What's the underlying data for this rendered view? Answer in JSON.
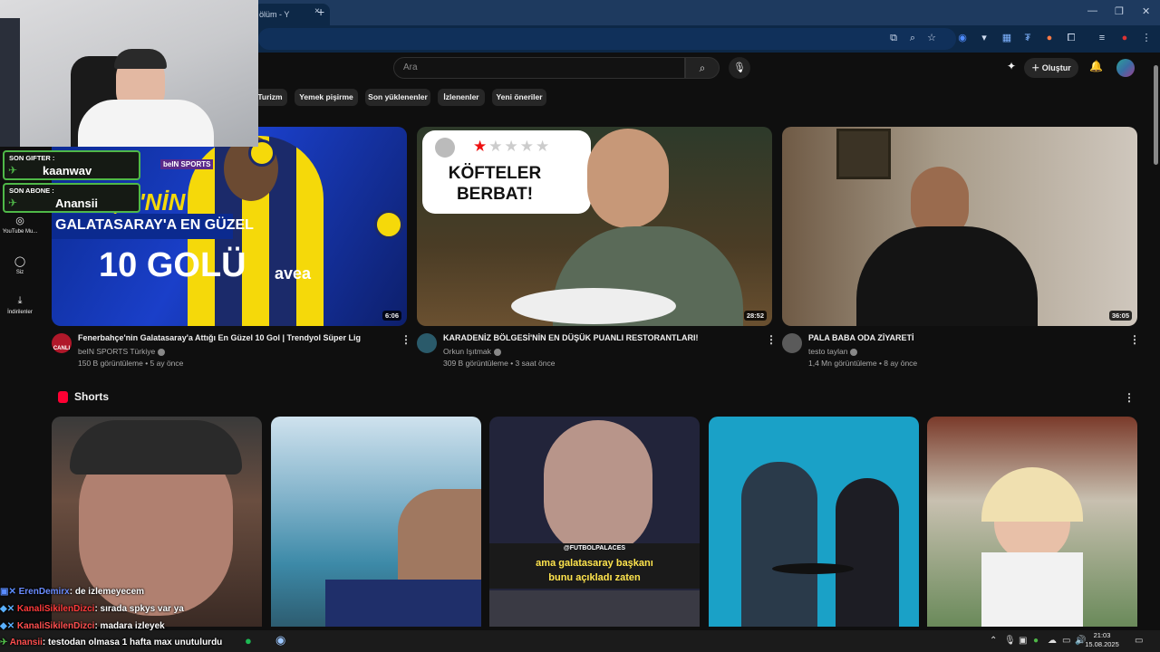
{
  "browser": {
    "tab_title": "ölüm - Y",
    "tab_close": "×",
    "new_tab": "+"
  },
  "header": {
    "search_placeholder": "Ara",
    "create_label": "Oluştur"
  },
  "chips": [
    "Turizm",
    "Yemek pişirme",
    "Son yüklenenler",
    "İzlenenler",
    "Yeni öneriler"
  ],
  "sidebar": {
    "items": [
      {
        "label": "YouTube Mu...",
        "icon": "youtube-music-icon"
      },
      {
        "label": "Siz",
        "icon": "user-icon"
      },
      {
        "label": "İndirilenler",
        "icon": "download-icon"
      }
    ]
  },
  "stream_overlay": {
    "gifter_label": "SON GIFTER :",
    "gifter_name": "kaanwav",
    "sub_label": "SON ABONE :",
    "sub_name": "Anansii"
  },
  "videos": [
    {
      "title": "Fenerbahçe'nin Galatasaray'a Attığı En Güzel 10 Gol | Trendyol Süper Lig",
      "channel": "beIN SPORTS Türkiye",
      "meta": "150 B görüntüleme • 5 ay önce",
      "duration": "6:06",
      "thumb_line1": "BAHÇE'NİN",
      "thumb_line2": "GALATASARAY'A EN GÜZEL",
      "thumb_line3": "10 GOLÜ",
      "thumb_brand": "beIN SPORTS",
      "thumb_sponsor": "avea",
      "avatar_label": "CANLI"
    },
    {
      "title": "KARADENİZ BÖLGESİ'NİN EN DÜŞÜK PUANLI RESTORANTLARI!",
      "channel": "Orkun Işıtmak",
      "meta": "309 B görüntüleme • 3 saat önce",
      "duration": "28:52",
      "thumb_text": "KÖFTELER BERBAT!"
    },
    {
      "title": "PALA BABA ODA ZİYARETİ",
      "channel": "testo taylan",
      "meta": "1,4 Mn görüntüleme • 8 ay önce",
      "duration": "36:05"
    }
  ],
  "shorts": {
    "title": "Shorts",
    "caption_handle": "@FUTBOLPALACES",
    "caption_line1": "ama galatasaray başkanı",
    "caption_line2": "bunu açıkladı zaten"
  },
  "chat": [
    {
      "user": "ErenDemirx",
      "text": ": de izlemeyecem"
    },
    {
      "user": "KanaliSikilenDizci",
      "text": ": sırada spkys var ya"
    },
    {
      "user": "KanaliSikilenDizci",
      "text": ": madara izleyek"
    },
    {
      "user": "Anansii",
      "text": ": testodan olmasa 1 hafta max unutulurdu"
    }
  ],
  "taskbar": {
    "time": "21:03",
    "date": "15.08.2025"
  },
  "colors": {
    "accent_red": "#ff0033",
    "overlay_green": "#4fb848",
    "bg": "#0f0f0f"
  }
}
